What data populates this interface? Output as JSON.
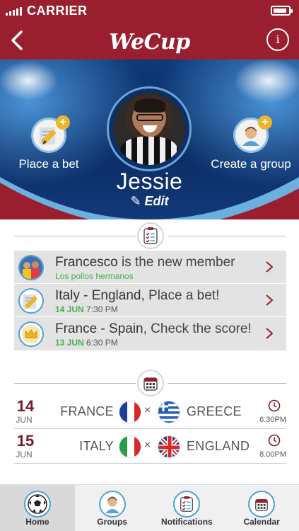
{
  "status_bar": {
    "carrier": "CARRIER"
  },
  "nav": {
    "title": "WeCup",
    "info_label": "i"
  },
  "hero": {
    "place_bet_label": "Place a bet",
    "create_group_label": "Create a group",
    "user_name": "Jessie",
    "edit_label": "Edit"
  },
  "activity": [
    {
      "bold": "Francesco",
      "rest": " is the new member",
      "sub_date": "",
      "sub_time": "",
      "sub_text": "Los pollos hermanos",
      "icon": "group-photo-icon"
    },
    {
      "bold": "Italy - England",
      "rest": ", Place a bet!",
      "sub_date": "14 JUN",
      "sub_time": "7:30 PM",
      "sub_text": "",
      "icon": "pencil-icon"
    },
    {
      "bold": "France - Spain",
      "rest": ", Check the score!",
      "sub_date": "13 JUN",
      "sub_time": "6:30 PM",
      "sub_text": "",
      "icon": "crown-icon"
    }
  ],
  "matches": [
    {
      "day": "14",
      "month": "JUN",
      "team1": "FRANCE",
      "team2": "GREECE",
      "vs": "×",
      "time": "6.30PM"
    },
    {
      "day": "15",
      "month": "JUN",
      "team1": "ITALY",
      "team2": "ENGLAND",
      "vs": "×",
      "time": "8.00PM"
    }
  ],
  "tabs": [
    {
      "label": "Home",
      "icon": "soccer-ball-icon",
      "active": true
    },
    {
      "label": "Groups",
      "icon": "person-icon",
      "active": false
    },
    {
      "label": "Notifications",
      "icon": "clipboard-icon",
      "active": false
    },
    {
      "label": "Calendar",
      "icon": "calendar-icon",
      "active": false
    }
  ],
  "colors": {
    "brand": "#9a1f2e",
    "accent": "#4aa3d6",
    "green": "#4caf50",
    "plus": "#f0b429"
  }
}
